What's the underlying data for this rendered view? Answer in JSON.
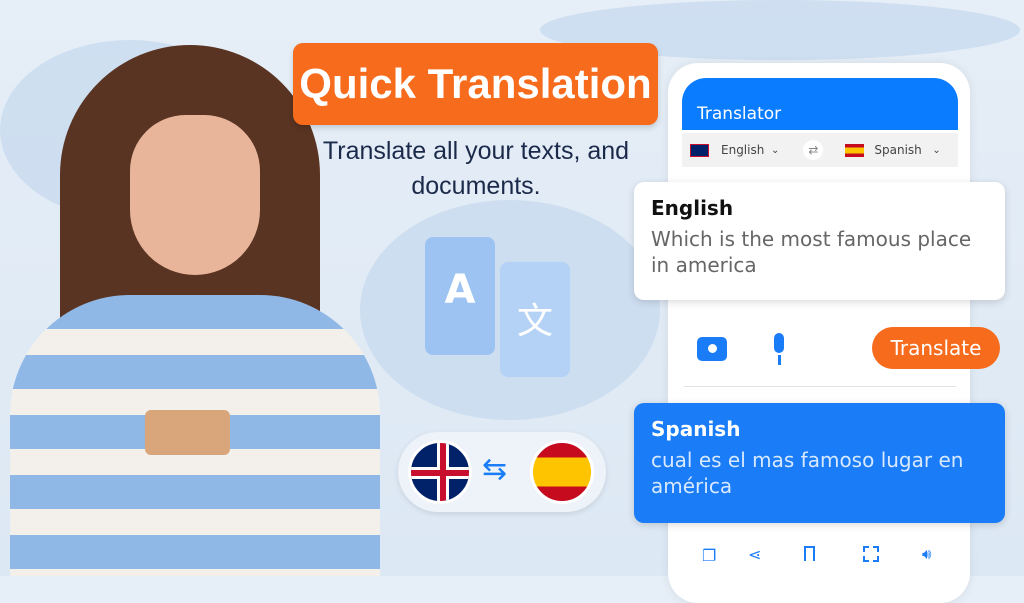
{
  "banner": {
    "title": "Quick Translation",
    "subtitle": "Translate all your texts, and documents."
  },
  "app": {
    "title": "Translator",
    "source_lang": "English",
    "target_lang": "Spanish",
    "source_card": {
      "label": "English",
      "text": "Which is the most famous place in america"
    },
    "translate_label": "Translate",
    "target_card": {
      "label": "Spanish",
      "text": "cual es el mas famoso lugar en américa"
    },
    "bottom_icons": [
      "copy-icon",
      "share-icon",
      "bookmark-icon",
      "fullscreen-icon",
      "speaker-icon"
    ]
  },
  "colors": {
    "accent": "#f76b1c",
    "brand": "#0a7cff",
    "text": "#1b2a4a"
  }
}
